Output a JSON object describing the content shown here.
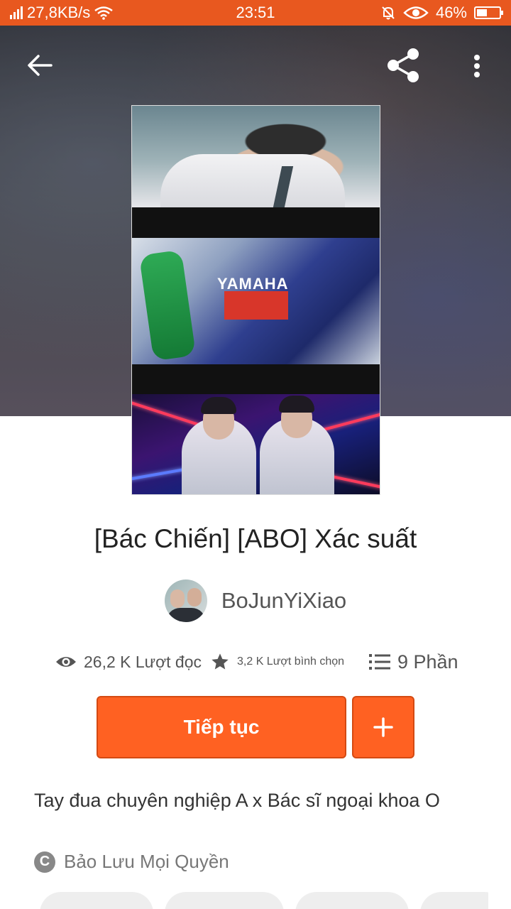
{
  "status_bar": {
    "network_speed": "27,8KB/s",
    "time": "23:51",
    "battery": "46%",
    "battery_level": 0.46
  },
  "toolbar": {
    "back_icon": "arrow-left-icon",
    "share_icon": "share-icon",
    "menu_icon": "more-vertical-icon"
  },
  "story": {
    "title": "[Bác Chiến] [ABO] Xác suất",
    "author": "BoJunYiXiao",
    "reads": "26,2 K Lượt đọc",
    "votes": "3,2 K Lượt bình chọn",
    "parts": "9 Phần",
    "description": "Tay đua chuyên nghiệp A x Bác sĩ ngoại khoa O",
    "copyright": "Bảo Lưu Mọi Quyền"
  },
  "cover_text": {
    "jersey": "YAMAHA"
  },
  "actions": {
    "continue_label": "Tiếp tục",
    "add_icon": "plus-icon"
  },
  "colors": {
    "accent": "#ff6122",
    "status_bar": "#e8581f"
  }
}
